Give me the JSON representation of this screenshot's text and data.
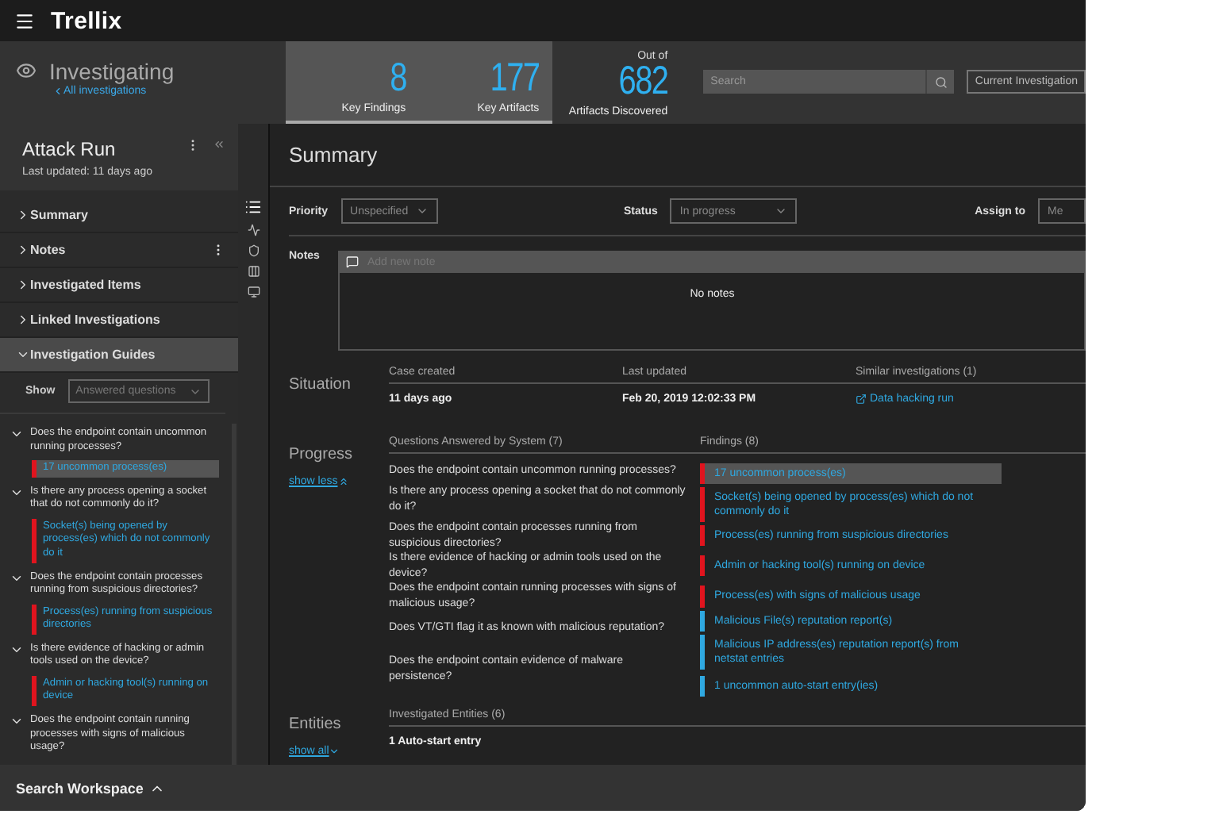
{
  "topbar": {
    "logo": "Trellix"
  },
  "header": {
    "title": "Investigating",
    "back_link": "All investigations",
    "stats": [
      {
        "value": "8",
        "label": "Key Findings",
        "highlighted": true
      },
      {
        "value": "177",
        "label": "Key Artifacts",
        "highlighted": true
      },
      {
        "caption": "Out of",
        "value": "682",
        "label": "Artifacts Discovered",
        "highlighted": false
      }
    ],
    "search": {
      "placeholder": "Search"
    },
    "scope": {
      "value": "Current Investigation"
    }
  },
  "sidebar": {
    "title": "Attack Run",
    "subtitle": "Last updated: 11 days ago",
    "sections": [
      {
        "label": "Summary",
        "expanded": false,
        "selected": false,
        "has_menu": false
      },
      {
        "label": "Notes",
        "expanded": false,
        "selected": false,
        "has_menu": true
      },
      {
        "label": "Investigated Items",
        "expanded": false,
        "selected": false,
        "has_menu": false
      },
      {
        "label": "Linked Investigations",
        "expanded": false,
        "selected": false,
        "has_menu": false
      },
      {
        "label": "Investigation Guides",
        "expanded": true,
        "selected": true,
        "has_menu": false
      }
    ],
    "show": {
      "label": "Show",
      "value": "Answered questions"
    },
    "questions": [
      {
        "question": "Does the endpoint contain uncommon running processes?",
        "expanded": true,
        "findings": [
          {
            "text": "17 uncommon process(es)",
            "color": "#e0141e",
            "selected": true
          }
        ]
      },
      {
        "question": "Is there any process opening a socket that do not commonly do it?",
        "expanded": true,
        "findings": [
          {
            "text": "Socket(s) being opened by process(es) which do not commonly do it",
            "color": "#e0141e",
            "selected": false
          }
        ]
      },
      {
        "question": "Does the endpoint contain processes running from suspicious directories?",
        "expanded": true,
        "findings": [
          {
            "text": "Process(es) running from suspicious directories",
            "color": "#e0141e",
            "selected": false
          }
        ]
      },
      {
        "question": "Is there evidence of hacking or admin tools used on the device?",
        "expanded": true,
        "findings": [
          {
            "text": "Admin or hacking tool(s) running on device",
            "color": "#e0141e",
            "selected": false
          }
        ]
      },
      {
        "question": "Does the endpoint contain running processes with signs of malicious usage?",
        "expanded": true
      }
    ]
  },
  "rail": [
    {
      "selected": true
    },
    {
      "selected": false
    },
    {
      "selected": false
    },
    {
      "selected": false
    },
    {
      "selected": false
    }
  ],
  "main": {
    "title": "Summary",
    "fields": [
      {
        "label": "Priority",
        "value": "Unspecified"
      },
      {
        "label": "Status",
        "value": "In progress"
      },
      {
        "label": "Assign to",
        "value": "Me"
      }
    ],
    "notes": {
      "label": "Notes",
      "placeholder": "Add new note",
      "empty": "No notes"
    },
    "situation": {
      "title": "Situation",
      "columns": [
        {
          "heading": "Case created",
          "value": "11 days ago",
          "kind": "text"
        },
        {
          "heading": "Last updated",
          "value": "Feb 20, 2019 12:02:33 PM",
          "kind": "text"
        },
        {
          "heading": "Similar investigations (1)",
          "value": "Data hacking run",
          "kind": "link"
        }
      ]
    },
    "progress": {
      "title": "Progress",
      "link": "show less",
      "questions_heading": "Questions Answered by System (7)",
      "questions": [
        "Does the endpoint contain uncommon running processes?",
        "Is there any process opening a socket that do not commonly do it?",
        "Does the endpoint contain processes running from suspicious directories?",
        "Is there evidence of hacking or admin tools used on the device?",
        "Does the endpoint contain running processes with signs of malicious usage?",
        "Does VT/GTI flag it as known with malicious reputation?",
        "Does the endpoint contain evidence of malware persistence?"
      ],
      "findings_heading": "Findings (8)",
      "findings": [
        {
          "text": "17 uncommon process(es)",
          "color": "#e0141e",
          "selected": true
        },
        {
          "text": "Socket(s) being opened by process(es) which do not commonly do it",
          "color": "#e0141e",
          "selected": false
        },
        {
          "text": "Process(es) running from suspicious directories",
          "color": "#e0141e",
          "selected": false
        },
        {
          "text": "Admin or hacking tool(s) running on device",
          "color": "#e0141e",
          "selected": false
        },
        {
          "text": "Process(es) with signs of malicious usage",
          "color": "#e0141e",
          "selected": false
        },
        {
          "text": "Malicious File(s) reputation report(s)",
          "color": "#2fa8e0",
          "selected": false
        },
        {
          "text": "Malicious IP address(es) reputation report(s) from netstat entries",
          "color": "#2fa8e0",
          "selected": false
        },
        {
          "text": "1 uncommon auto-start entry(ies)",
          "color": "#2fa8e0",
          "selected": false
        }
      ]
    },
    "entities": {
      "title": "Entities",
      "link": "show all",
      "heading": "Investigated Entities (6)",
      "rows": [
        "1 Auto-start entry"
      ]
    }
  },
  "bottom_bar": {
    "label": "Search Workspace"
  }
}
